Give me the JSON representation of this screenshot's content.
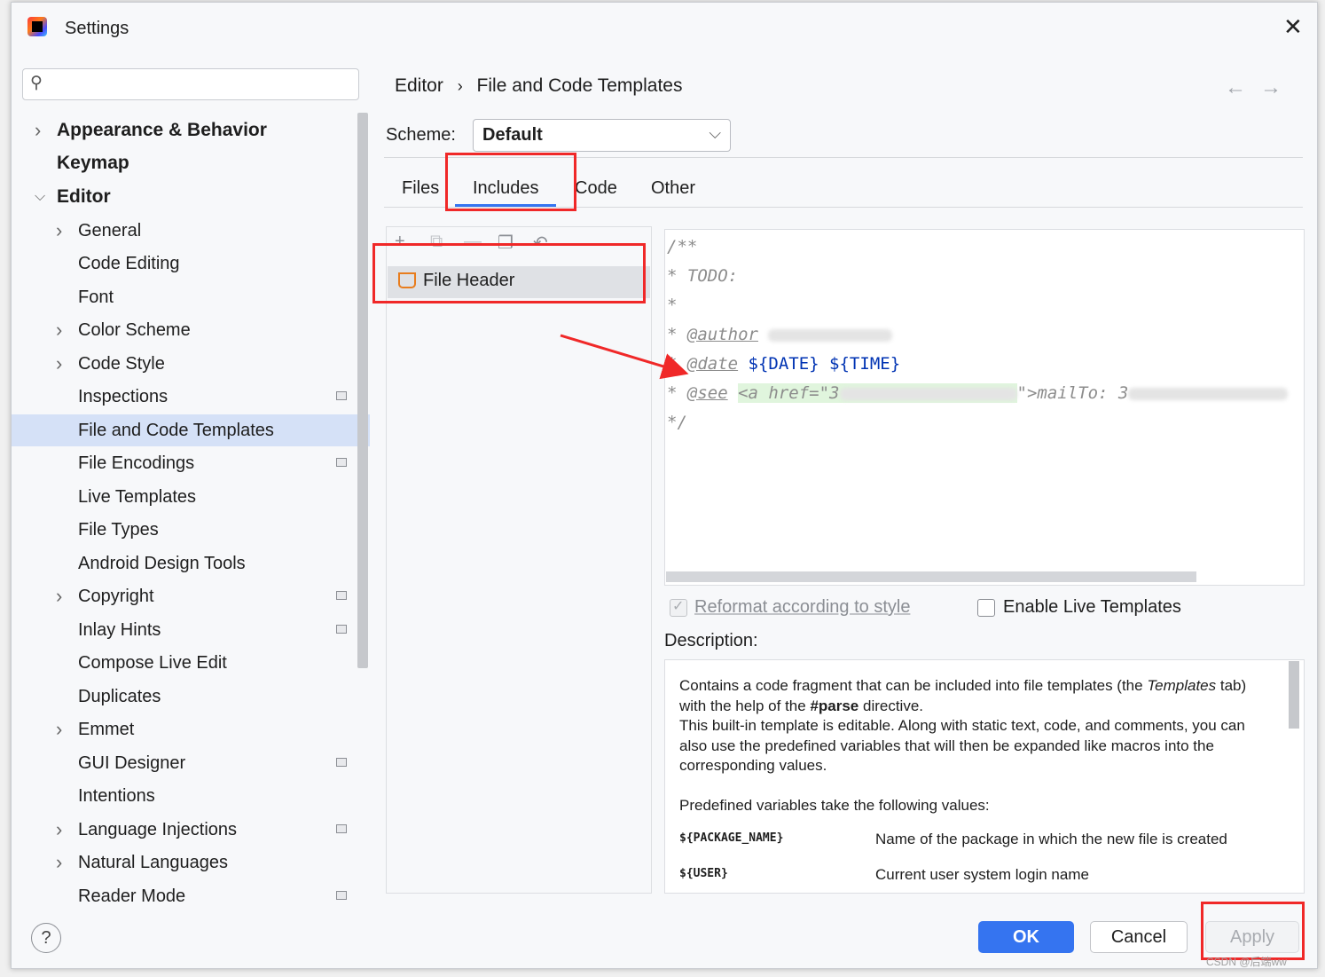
{
  "window": {
    "title": "Settings"
  },
  "search": {
    "placeholder": ""
  },
  "tree": [
    {
      "label": "Appearance & Behavior",
      "level": 0,
      "bold": true,
      "expandable": true,
      "expanded": false
    },
    {
      "label": "Keymap",
      "level": 0,
      "bold": true,
      "expandable": false
    },
    {
      "label": "Editor",
      "level": 0,
      "bold": true,
      "expandable": true,
      "expanded": true
    },
    {
      "label": "General",
      "level": 1,
      "expandable": true
    },
    {
      "label": "Code Editing",
      "level": 1
    },
    {
      "label": "Font",
      "level": 1
    },
    {
      "label": "Color Scheme",
      "level": 1,
      "expandable": true
    },
    {
      "label": "Code Style",
      "level": 1,
      "expandable": true
    },
    {
      "label": "Inspections",
      "level": 1,
      "marker": true
    },
    {
      "label": "File and Code Templates",
      "level": 1,
      "selected": true
    },
    {
      "label": "File Encodings",
      "level": 1,
      "marker": true
    },
    {
      "label": "Live Templates",
      "level": 1
    },
    {
      "label": "File Types",
      "level": 1
    },
    {
      "label": "Android Design Tools",
      "level": 1
    },
    {
      "label": "Copyright",
      "level": 1,
      "expandable": true,
      "marker": true
    },
    {
      "label": "Inlay Hints",
      "level": 1,
      "marker": true
    },
    {
      "label": "Compose Live Edit",
      "level": 1
    },
    {
      "label": "Duplicates",
      "level": 1
    },
    {
      "label": "Emmet",
      "level": 1,
      "expandable": true
    },
    {
      "label": "GUI Designer",
      "level": 1,
      "marker": true
    },
    {
      "label": "Intentions",
      "level": 1
    },
    {
      "label": "Language Injections",
      "level": 1,
      "expandable": true,
      "marker": true
    },
    {
      "label": "Natural Languages",
      "level": 1,
      "expandable": true
    },
    {
      "label": "Reader Mode",
      "level": 1,
      "marker": true
    }
  ],
  "breadcrumb": {
    "parent": "Editor",
    "separator": "›",
    "current": "File and Code Templates"
  },
  "nav": {
    "back": "←",
    "forward": "→"
  },
  "scheme": {
    "label": "Scheme:",
    "value": "Default"
  },
  "tabs": [
    "Files",
    "Includes",
    "Code",
    "Other"
  ],
  "active_tab": "Includes",
  "template_list": {
    "items": [
      {
        "label": "File Header"
      }
    ]
  },
  "code": {
    "line1": "/**",
    "line2": " * TODO:",
    "line3": " *",
    "star": " * ",
    "author_tag": "@author",
    "date_tag": "@date",
    "date_vars": "${DATE} ${TIME}",
    "see_tag": "@see",
    "see_open": "<a href=\"3",
    "see_close": "\">mailTo: 3",
    "line7": " */"
  },
  "options": {
    "reformat_label": "Reformat according to style",
    "reformat_checked": true,
    "live_templates_label": "Enable Live Templates",
    "live_templates_checked": false
  },
  "description": {
    "label": "Description:",
    "p1_a": "Contains a code fragment that can be included into file templates (the ",
    "p1_em": "Templates",
    "p1_b": " tab) with the help of the ",
    "p1_strong": "#parse",
    "p1_c": " directive.",
    "p2": "This built-in template is editable. Along with static text, code, and comments, you can also use the predefined variables that will then be expanded like macros into the corresponding values.",
    "p3": "Predefined variables take the following values:",
    "vars": [
      {
        "name": "${PACKAGE_NAME}",
        "desc": "Name of the package in which the new file is created"
      },
      {
        "name": "${USER}",
        "desc": "Current user system login name"
      }
    ]
  },
  "buttons": {
    "ok": "OK",
    "cancel": "Cancel",
    "apply": "Apply",
    "help": "?"
  },
  "watermark": "CSDN @后端ww",
  "colors": {
    "accent": "#3574f0",
    "selection": "#d5e1f7",
    "highlight_red": "#f02828",
    "code_tag": "#0033b3"
  }
}
